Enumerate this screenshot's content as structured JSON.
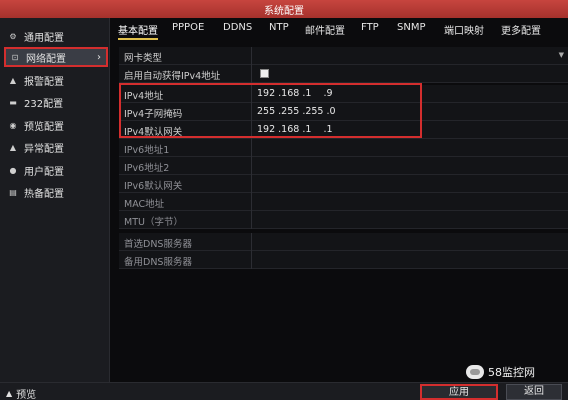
{
  "window": {
    "title": "系统配置"
  },
  "sidebar": {
    "items": [
      {
        "label": "通用配置",
        "icon": "gear-icon",
        "glyph": "⚙"
      },
      {
        "label": "网络配置",
        "icon": "network-icon",
        "glyph": "⊡",
        "active": true
      },
      {
        "label": "报警配置",
        "icon": "alarm-icon",
        "glyph": "▲"
      },
      {
        "label": "232配置",
        "icon": "serial-icon",
        "glyph": "▬"
      },
      {
        "label": "预览配置",
        "icon": "eye-icon",
        "glyph": "◉"
      },
      {
        "label": "异常配置",
        "icon": "warning-icon",
        "glyph": "▲"
      },
      {
        "label": "用户配置",
        "icon": "user-icon",
        "glyph": "●"
      },
      {
        "label": "热备配置",
        "icon": "hotspare-icon",
        "glyph": "▤"
      }
    ],
    "active_chevron": "›"
  },
  "tabs": [
    "基本配置",
    "PPPOE",
    "DDNS",
    "NTP",
    "邮件配置",
    "FTP",
    "SNMP",
    "端口映射",
    "更多配置"
  ],
  "form": {
    "rows": [
      {
        "label": "网卡类型",
        "value": "",
        "type": "select"
      },
      {
        "label": "启用自动获得IPv4地址",
        "value": "",
        "type": "checkbox"
      },
      {
        "label": "IPv4地址",
        "value": "192 .168 .1    .9",
        "type": "text"
      },
      {
        "label": "IPv4子网掩码",
        "value": "255 .255 .255 .0",
        "type": "text"
      },
      {
        "label": "IPv4默认网关",
        "value": "192 .168 .1    .1",
        "type": "text"
      },
      {
        "label": "IPv6地址1",
        "value": "",
        "type": "text",
        "dim": true
      },
      {
        "label": "IPv6地址2",
        "value": "",
        "type": "text",
        "dim": true
      },
      {
        "label": "IPv6默认网关",
        "value": "",
        "type": "text",
        "dim": true
      },
      {
        "label": "MAC地址",
        "value": "",
        "type": "text",
        "dim": true
      },
      {
        "label": "MTU（字节）",
        "value": "",
        "type": "text",
        "dim": true
      },
      {
        "label": "首选DNS服务器",
        "value": "",
        "type": "text",
        "dim": true
      },
      {
        "label": "备用DNS服务器",
        "value": "",
        "type": "text",
        "dim": true
      }
    ]
  },
  "bottom": {
    "preview_label": "预览",
    "preview_glyph": "▲",
    "apply_label": "应用",
    "back_label": "返回"
  },
  "watermark": {
    "text": "58监控网"
  },
  "colors": {
    "titlebar": "#b8392f",
    "highlight": "#d42e2e",
    "tab_underline": "#e0c04c"
  }
}
